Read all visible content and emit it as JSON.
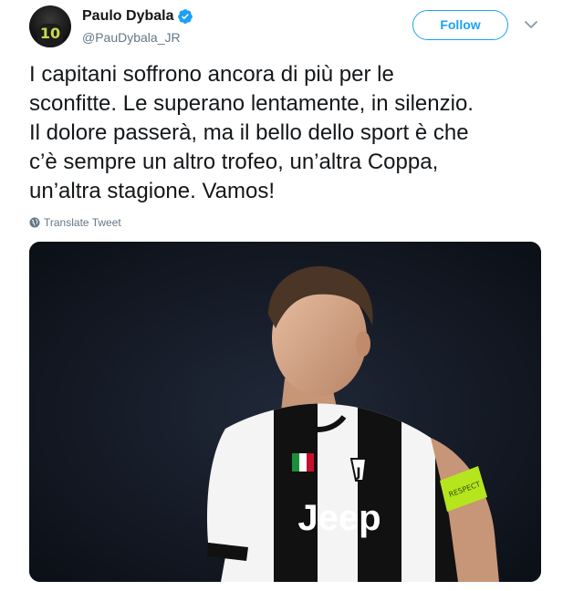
{
  "author": {
    "display_name": "Paulo Dybala",
    "handle": "@PauDybala_JR",
    "avatar_shirt_number": "10",
    "verified": true
  },
  "follow_label": "Follow",
  "tweet": {
    "lines": [
      "I capitani soffrono ancora di più per le",
      "sconfitte. Le superano lentamente, in silenzio.",
      "Il dolore passerà, ma il bello dello sport è che",
      "c’è sempre un altro trofeo, un’altra Coppa,",
      "un’altra stagione. Vamos!"
    ]
  },
  "translate_label": "Translate Tweet",
  "media": {
    "shirt_sponsor": "Jeep",
    "armband_text": "RESPECT"
  },
  "colors": {
    "accent": "#1da1f2",
    "text": "#14171a",
    "secondary_text": "#657786",
    "armband": "#b5e61d"
  },
  "icons": {
    "verified": "verified-badge-icon",
    "more": "chevron-down-icon",
    "translate": "globe-icon"
  }
}
